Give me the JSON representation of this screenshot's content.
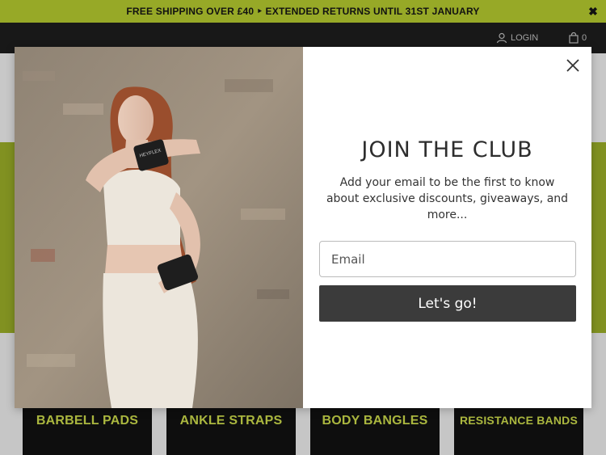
{
  "announcement": {
    "text": "FREE SHIPPING OVER £40 ‣ EXTENDED RETURNS UNTIL 31ST JANUARY",
    "close_icon": "close-icon"
  },
  "nav": {
    "login_label": "LOGIN",
    "cart_count": "0"
  },
  "categories": [
    {
      "label": "BARBELL PADS"
    },
    {
      "label": "ANKLE STRAPS"
    },
    {
      "label": "BODY BANGLES"
    },
    {
      "label": "RESISTANCE BANDS"
    }
  ],
  "modal": {
    "title": "JOIN THE CLUB",
    "subtitle": "Add your email to be the first to know about exclusive discounts, giveaways, and more...",
    "email_placeholder": "Email",
    "email_value": "",
    "submit_label": "Let's go!",
    "wristband_text": "HEYFLEX"
  },
  "colors": {
    "accent": "#97a927",
    "dark": "#1c1c1c",
    "button": "#3b3b3b",
    "category_text": "#c7d64a"
  }
}
